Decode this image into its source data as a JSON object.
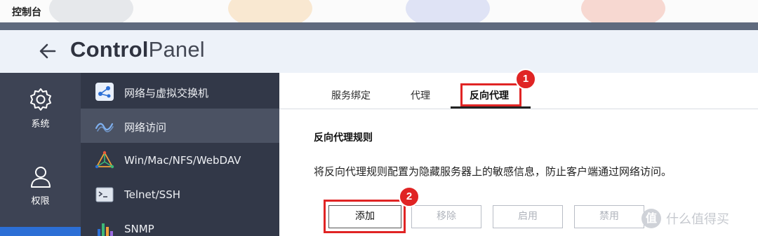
{
  "window": {
    "title": "控制台"
  },
  "header": {
    "title_a": "Control",
    "title_b": "Panel"
  },
  "rail": {
    "items": [
      {
        "label": "系统",
        "icon": "gear-icon"
      },
      {
        "label": "权限",
        "icon": "user-icon"
      }
    ]
  },
  "nav": {
    "items": [
      {
        "label": "网络与虚拟交换机",
        "icon": "network-switch-icon"
      },
      {
        "label": "网络访问",
        "icon": "wave-icon"
      },
      {
        "label": "Win/Mac/NFS/WebDAV",
        "icon": "triangle-nodes-icon"
      },
      {
        "label": "Telnet/SSH",
        "icon": "terminal-icon"
      },
      {
        "label": "SNMP",
        "icon": "bar-chart-icon"
      }
    ]
  },
  "tabs": [
    {
      "label": "服务绑定"
    },
    {
      "label": "代理"
    },
    {
      "label": "反向代理"
    }
  ],
  "main": {
    "section_title": "反向代理规则",
    "description": "将反向代理规则配置为隐藏服务器上的敏感信息，防止客户端通过网络访问。"
  },
  "buttons": {
    "add": "添加",
    "remove": "移除",
    "enable": "启用",
    "disable": "禁用"
  },
  "annotations": {
    "badge1": "1",
    "badge2": "2"
  },
  "watermark": {
    "icon": "值",
    "text": "什么值得买"
  },
  "colors": {
    "accent": "#2c6fd6",
    "highlight": "#e02424",
    "rail": "#3d4354",
    "nav": "#323848"
  }
}
